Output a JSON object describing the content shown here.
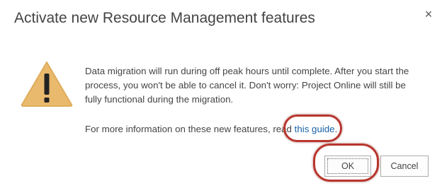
{
  "dialog": {
    "title": "Activate new Resource Management features",
    "close_glyph": "×",
    "message": "Data migration will run during off peak hours until complete. After you start the process, you won't be able to cancel it. Don't worry: Project Online will still be fully functional during the migration.",
    "info_prefix": "For more information on these new features, read",
    "info_link": "this guide",
    "info_suffix": ".",
    "ok_label": "OK",
    "cancel_label": "Cancel",
    "icon": "warning-triangle-icon",
    "colors": {
      "warning_fill": "#e9b96e",
      "link": "#1a63a8",
      "highlight_circle": "#b8362e"
    }
  }
}
